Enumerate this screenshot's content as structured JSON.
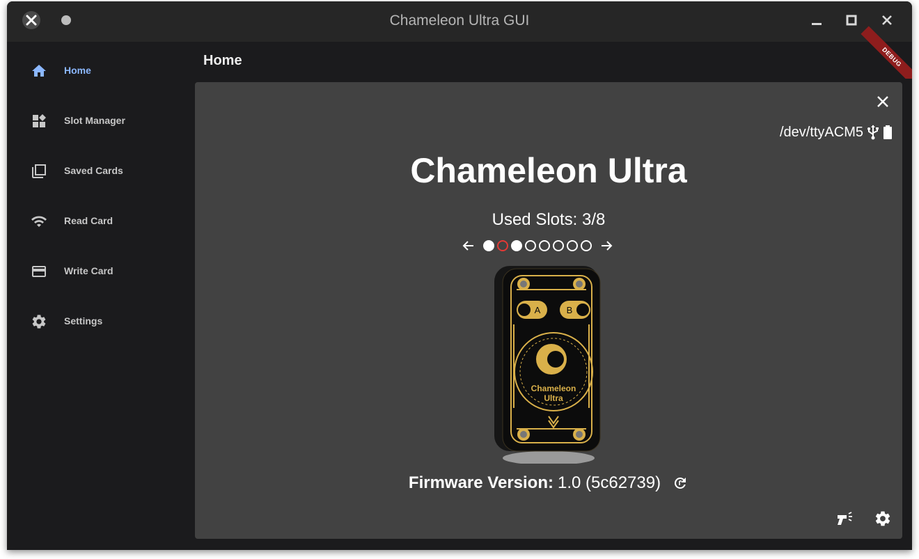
{
  "window": {
    "title": "Chameleon Ultra GUI"
  },
  "sidebar": {
    "items": [
      {
        "label": "Home",
        "icon": "home-icon",
        "active": true
      },
      {
        "label": "Slot Manager",
        "icon": "dashboard-icon",
        "active": false
      },
      {
        "label": "Saved Cards",
        "icon": "library-icon",
        "active": false
      },
      {
        "label": "Read Card",
        "icon": "wifi-icon",
        "active": false
      },
      {
        "label": "Write Card",
        "icon": "credit-card-icon",
        "active": false
      },
      {
        "label": "Settings",
        "icon": "gear-icon",
        "active": false
      }
    ]
  },
  "appbar": {
    "title": "Home",
    "debug_banner": "DEBUG"
  },
  "device": {
    "port": "/dev/ttyACM5",
    "name": "Chameleon Ultra",
    "used_slots_text": "Used Slots: 3/8",
    "slots": [
      "used",
      "selected",
      "used",
      "empty",
      "empty",
      "empty",
      "empty",
      "empty"
    ],
    "image_text_line1": "Chameleon",
    "image_text_line2": "Ultra",
    "button_a": "A",
    "button_b": "B",
    "firmware_label": "Firmware Version:",
    "firmware_value": "1.0 (5c62739)"
  },
  "colors": {
    "accent": "#8cb8ff",
    "selected_slot": "#e53935",
    "card_bg": "#424242",
    "sidebar_bg": "#1b1b1d",
    "debug_banner": "#8e1d1d"
  }
}
